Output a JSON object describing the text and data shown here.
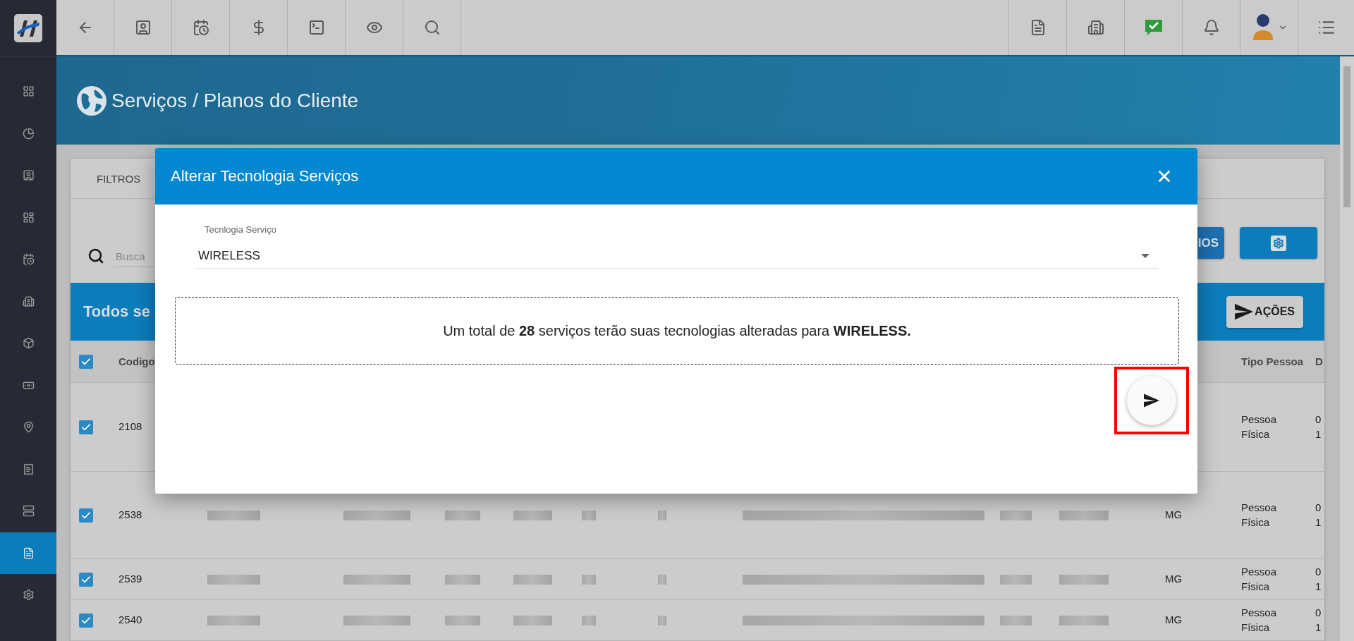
{
  "sidebar": {
    "items": [
      {
        "selected": false
      },
      {
        "selected": false
      },
      {
        "selected": false
      },
      {
        "selected": false
      },
      {
        "selected": false
      },
      {
        "selected": false
      },
      {
        "selected": false
      },
      {
        "selected": false
      },
      {
        "selected": false
      },
      {
        "selected": false
      },
      {
        "selected": false
      },
      {
        "selected": true
      },
      {
        "selected": false
      }
    ]
  },
  "header": {
    "title": "Serviços / Planos do Cliente"
  },
  "card": {
    "filter_tab": "FILTROS",
    "search": {
      "placeholder": "Busca"
    },
    "report_button": "IOS",
    "table_title": "Todos se",
    "actions_button": "AÇÕES"
  },
  "table": {
    "select_all_checked": true,
    "columns": [
      "Codigo",
      "Tipo Pessoa",
      "D"
    ],
    "rows": [
      {
        "checked": true,
        "code": "2108",
        "uf": "",
        "tipo": "Pessoa Física",
        "date_lines": [
          "0",
          "1"
        ]
      },
      {
        "checked": true,
        "code": "2538",
        "uf": "MG",
        "tipo": "Pessoa Física",
        "date_lines": [
          "0",
          "1"
        ]
      },
      {
        "checked": true,
        "code": "2539",
        "uf": "MG",
        "tipo": "Pessoa Física",
        "date_lines": [
          "0",
          "1"
        ]
      },
      {
        "checked": true,
        "code": "2540",
        "uf": "MG",
        "tipo": "Pessoa Física",
        "date_lines": [
          "0",
          "1"
        ]
      }
    ]
  },
  "dialog": {
    "title": "Alterar Tecnologia Serviços",
    "field": {
      "label": "Tecnlogia Serviço",
      "value": "WIRELESS"
    },
    "message": "Um total de **28** serviços terão suas tecnologias alteradas para **WIRELESS.**",
    "submit_highlighted": true
  }
}
